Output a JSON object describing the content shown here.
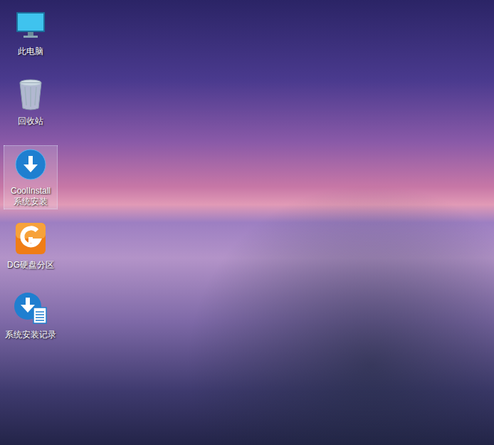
{
  "desktop": {
    "icons": [
      {
        "kind": "computer",
        "lines": [
          "此电脑"
        ],
        "selected": false
      },
      {
        "kind": "recycle-bin",
        "lines": [
          "回收站"
        ],
        "selected": false
      },
      {
        "kind": "installer",
        "lines": [
          "CoolInstall",
          "系统安装"
        ],
        "selected": true
      },
      {
        "kind": "partition",
        "lines": [
          "DG硬盘分区"
        ],
        "selected": false
      },
      {
        "kind": "log",
        "lines": [
          "系统安装记录"
        ],
        "selected": false
      }
    ]
  }
}
